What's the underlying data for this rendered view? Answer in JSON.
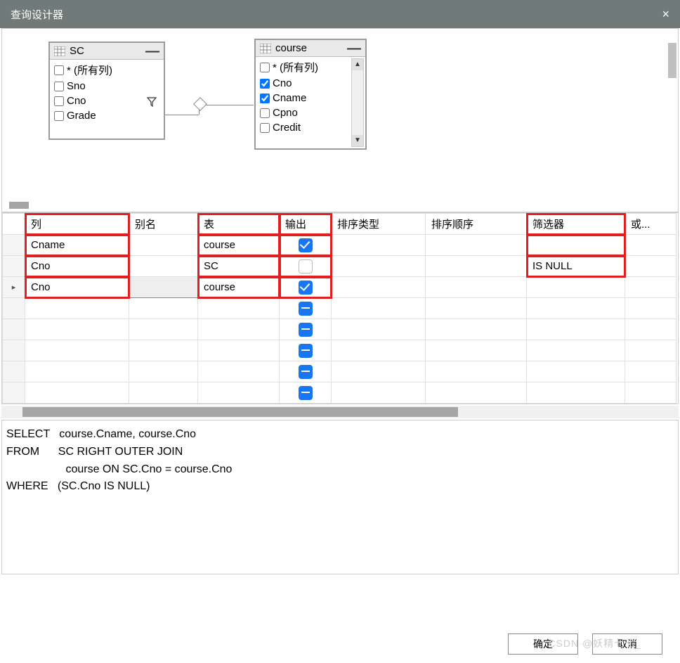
{
  "window": {
    "title": "查询设计器",
    "close_icon": "×"
  },
  "tables": {
    "sc": {
      "name": "SC",
      "columns": [
        {
          "label": "* (所有列)",
          "checked": false
        },
        {
          "label": "Sno",
          "checked": false
        },
        {
          "label": "Cno",
          "checked": false
        },
        {
          "label": "Grade",
          "checked": false
        }
      ]
    },
    "course": {
      "name": "course",
      "columns": [
        {
          "label": "* (所有列)",
          "checked": false
        },
        {
          "label": "Cno",
          "checked": true
        },
        {
          "label": "Cname",
          "checked": true
        },
        {
          "label": "Cpno",
          "checked": false
        },
        {
          "label": "Credit",
          "checked": false
        }
      ]
    }
  },
  "grid": {
    "headers": {
      "column": "列",
      "alias": "别名",
      "table": "表",
      "output": "输出",
      "sort_type": "排序类型",
      "sort_order": "排序顺序",
      "filter": "筛选器",
      "or": "或..."
    },
    "rows": [
      {
        "col": "Cname",
        "alias": "",
        "table": "course",
        "output": "on",
        "filter": ""
      },
      {
        "col": "Cno",
        "alias": "",
        "table": "SC",
        "output": "off",
        "filter": "IS NULL"
      },
      {
        "col": "Cno",
        "alias": "",
        "table": "course",
        "output": "on",
        "filter": ""
      },
      {
        "col": "",
        "alias": "",
        "table": "",
        "output": "minus",
        "filter": ""
      },
      {
        "col": "",
        "alias": "",
        "table": "",
        "output": "minus",
        "filter": ""
      },
      {
        "col": "",
        "alias": "",
        "table": "",
        "output": "minus",
        "filter": ""
      },
      {
        "col": "",
        "alias": "",
        "table": "",
        "output": "minus",
        "filter": ""
      },
      {
        "col": "",
        "alias": "",
        "table": "",
        "output": "minus",
        "filter": ""
      }
    ]
  },
  "sql": "SELECT   course.Cname, course.Cno\nFROM      SC RIGHT OUTER JOIN\n                   course ON SC.Cno = course.Cno\nWHERE   (SC.Cno IS NULL)",
  "buttons": {
    "ok": "确定",
    "cancel": "取消"
  },
  "watermark": "CSDN @妖精七七_",
  "icons": {
    "minimize": "—",
    "arrow_up": "▲",
    "arrow_down": "▼"
  }
}
